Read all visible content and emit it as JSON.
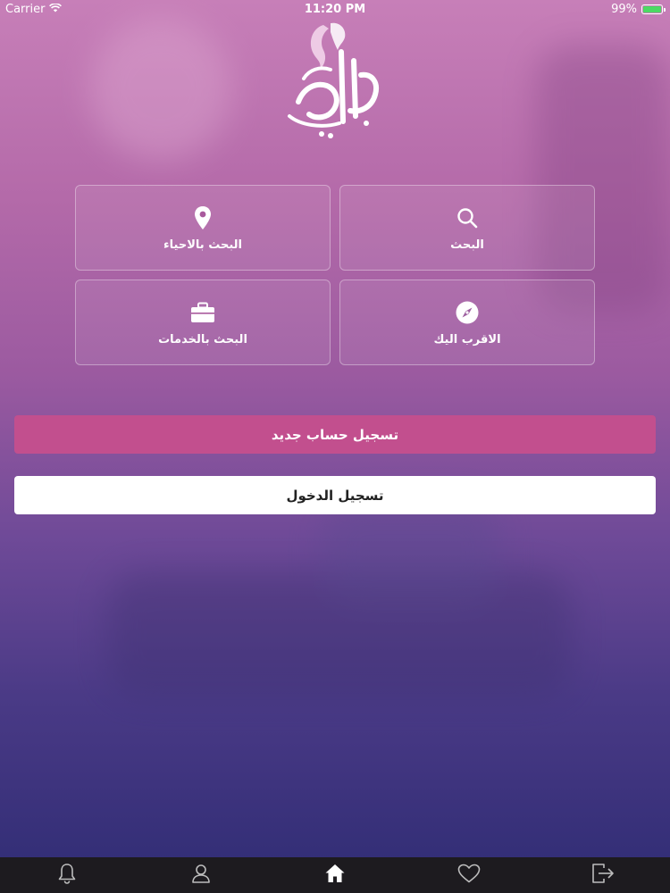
{
  "status_bar": {
    "carrier": "Carrier",
    "time": "11:20 PM",
    "battery": "99%",
    "battery_level": 0.99
  },
  "logo": {
    "text": "الجمالي",
    "color": "#ffffff"
  },
  "tiles": [
    {
      "label": "البحث",
      "icon": "search-icon"
    },
    {
      "label": "البحث بالاحياء",
      "icon": "location-pin-icon"
    },
    {
      "label": "الاقرب اليك",
      "icon": "compass-icon"
    },
    {
      "label": "البحث بالخدمات",
      "icon": "briefcase-icon"
    }
  ],
  "buttons": {
    "register": "تسجيل حساب جديد",
    "login": "تسجيل الدخول"
  },
  "colors": {
    "register_bg": "#c24f8e",
    "login_bg": "#ffffff",
    "tabbar_bg": "#1d1b1f",
    "battery_green": "#4cd964"
  },
  "tabbar": {
    "items": [
      {
        "icon": "bell-icon"
      },
      {
        "icon": "user-icon"
      },
      {
        "icon": "home-icon",
        "active": true
      },
      {
        "icon": "heart-icon"
      },
      {
        "icon": "logout-icon"
      }
    ]
  }
}
